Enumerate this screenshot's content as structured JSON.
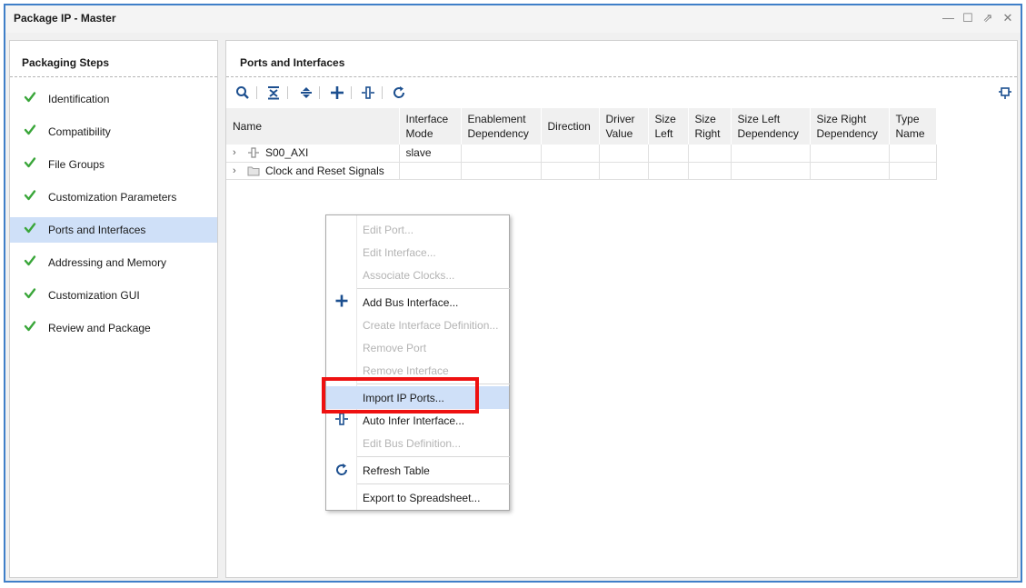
{
  "window": {
    "title": "Package IP - Master",
    "controls": {
      "minimize": "—",
      "maximize": "☐",
      "restore": "⇗",
      "close": "✕"
    }
  },
  "left_panel": {
    "title": "Packaging Steps",
    "steps": [
      {
        "label": "Identification",
        "done": true
      },
      {
        "label": "Compatibility",
        "done": true
      },
      {
        "label": "File Groups",
        "done": true
      },
      {
        "label": "Customization Parameters",
        "done": true
      },
      {
        "label": "Ports and Interfaces",
        "done": true,
        "selected": true
      },
      {
        "label": "Addressing and Memory",
        "done": true
      },
      {
        "label": "Customization GUI",
        "done": true
      },
      {
        "label": "Review and Package",
        "done": true
      }
    ]
  },
  "right_panel": {
    "title": "Ports and Interfaces",
    "toolbar": [
      "search-icon",
      "collapse-all-icon",
      "expand-all-icon",
      "add-icon",
      "auto-infer-icon",
      "refresh-icon",
      "pin-icon"
    ],
    "columns": [
      {
        "line1": "Name",
        "line2": ""
      },
      {
        "line1": "Interface",
        "line2": "Mode"
      },
      {
        "line1": "Enablement",
        "line2": "Dependency"
      },
      {
        "line1": "Direction",
        "line2": ""
      },
      {
        "line1": "Driver",
        "line2": "Value"
      },
      {
        "line1": "Size",
        "line2": "Left"
      },
      {
        "line1": "Size",
        "line2": "Right"
      },
      {
        "line1": "Size Left",
        "line2": "Dependency"
      },
      {
        "line1": "Size Right",
        "line2": "Dependency"
      },
      {
        "line1": "Type",
        "line2": "Name"
      }
    ],
    "rows": [
      {
        "name": "S00_AXI",
        "icon": "bus-interface-icon",
        "mode": "slave"
      },
      {
        "name": "Clock and Reset Signals",
        "icon": "folder-icon",
        "mode": ""
      }
    ]
  },
  "context_menu": {
    "items": [
      {
        "label": "Edit Port...",
        "enabled": false
      },
      {
        "label": "Edit Interface...",
        "enabled": false
      },
      {
        "label": "Associate Clocks...",
        "enabled": false
      },
      {
        "label": "Add Bus Interface...",
        "enabled": true,
        "icon": "plus-icon"
      },
      {
        "label": "Create Interface Definition...",
        "enabled": false
      },
      {
        "label": "Remove Port",
        "enabled": false
      },
      {
        "label": "Remove Interface",
        "enabled": false
      },
      {
        "label": "Import IP Ports...",
        "enabled": true,
        "hover": true
      },
      {
        "label": "Auto Infer Interface...",
        "enabled": true,
        "icon": "auto-infer-icon"
      },
      {
        "label": "Edit Bus Definition...",
        "enabled": false
      },
      {
        "label": "Refresh Table",
        "enabled": true,
        "icon": "refresh-icon"
      },
      {
        "label": "Export to Spreadsheet...",
        "enabled": true
      }
    ]
  },
  "colors": {
    "accent": "#3f7fc8",
    "check": "#3aa63a",
    "selection": "#cfe0f8",
    "highlight": "#ee1111",
    "icon": "#1c4f8f"
  }
}
